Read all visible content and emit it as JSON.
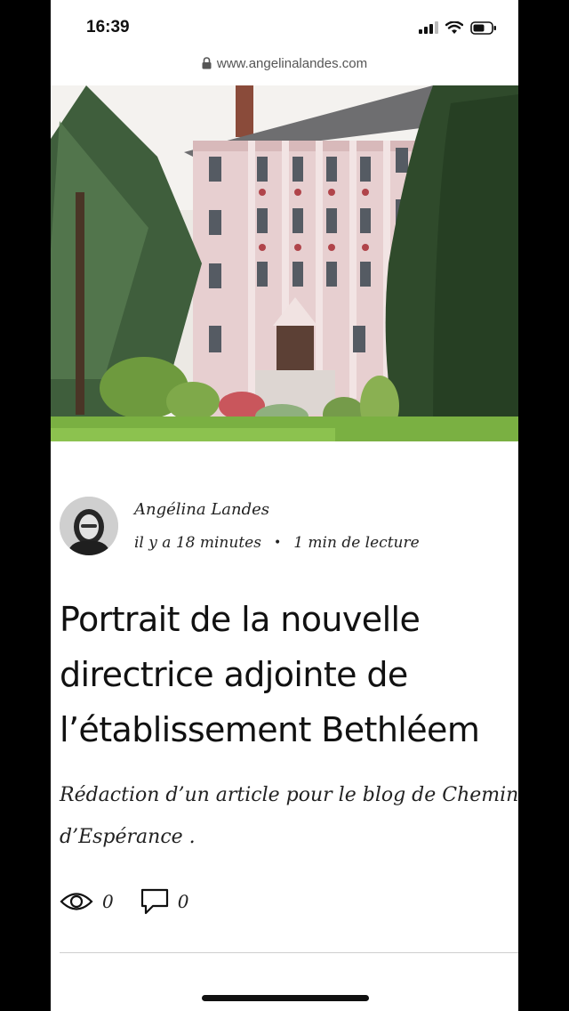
{
  "status_bar": {
    "time": "16:39"
  },
  "browser": {
    "url": "www.angelinalandes.com"
  },
  "post": {
    "author": "Angélina Landes",
    "posted_ago": "il y a 18 minutes",
    "separator": "•",
    "read_time": "1 min de lecture",
    "title_lines": [
      "Portrait de la nouvelle",
      "directrice adjointe de",
      "l’établissement Bethléem"
    ],
    "excerpt_lines": [
      "Rédaction d’un article pour le blog de Chemin",
      "d’Espérance ."
    ],
    "views": "0",
    "comments": "0"
  },
  "icons": {
    "signal": "signal-icon",
    "wifi": "wifi-icon",
    "battery": "battery-icon",
    "lock": "lock-icon",
    "views": "eye-icon",
    "comments": "comment-icon"
  }
}
